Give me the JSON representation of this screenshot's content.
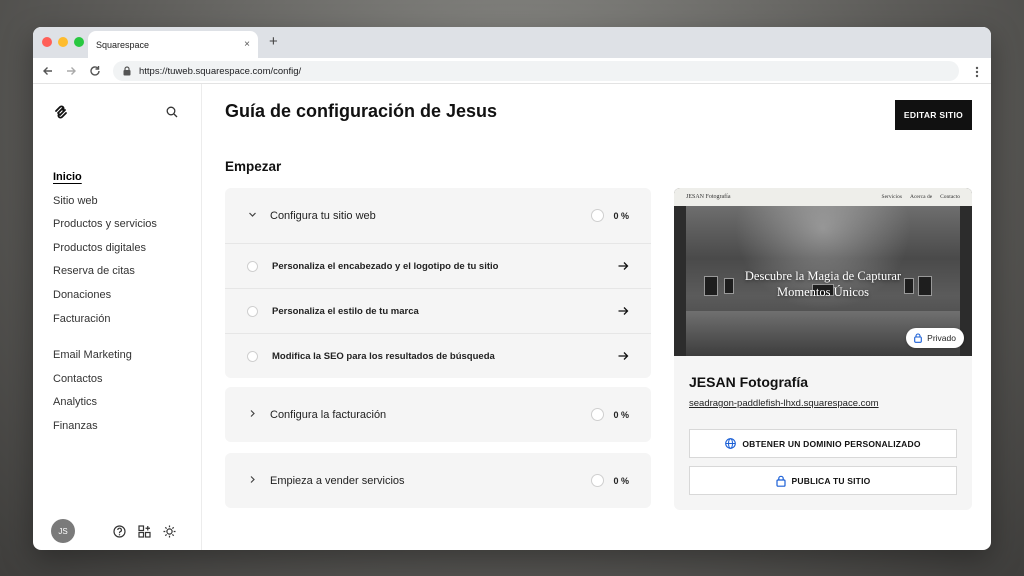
{
  "browser": {
    "tab_title": "Squarespace",
    "tab_close": "×",
    "new_tab": "+",
    "url": "https://tuweb.squarespace.com/config/"
  },
  "sidebar": {
    "nav_primary": [
      {
        "label": "Inicio",
        "active": true
      },
      {
        "label": "Sitio web"
      },
      {
        "label": "Productos y servicios"
      },
      {
        "label": "Productos digitales"
      },
      {
        "label": "Reserva de citas"
      },
      {
        "label": "Donaciones"
      },
      {
        "label": "Facturación"
      }
    ],
    "nav_secondary": [
      {
        "label": "Email Marketing"
      },
      {
        "label": "Contactos"
      },
      {
        "label": "Analytics"
      },
      {
        "label": "Finanzas"
      }
    ],
    "avatar_initials": "JS"
  },
  "main": {
    "title": "Guía de configuración de Jesus",
    "edit_button": "EDITAR SITIO",
    "section_title": "Empezar",
    "cards": [
      {
        "title": "Configura tu sitio web",
        "progress": "0 %",
        "expanded": true,
        "tasks": [
          "Personaliza el encabezado y el logotipo de tu sitio",
          "Personaliza el estilo de tu marca",
          "Modifica la SEO para los resultados de búsqueda"
        ]
      },
      {
        "title": "Configura la facturación",
        "progress": "0 %",
        "expanded": false
      },
      {
        "title": "Empieza a vender servicios",
        "progress": "0 %",
        "expanded": false
      }
    ]
  },
  "preview": {
    "thumb_brand": "JESAN Fotografía",
    "thumb_links": [
      "Servicios",
      "Acerca de",
      "Contacto"
    ],
    "hero_line1": "Descubre la Magia de Capturar",
    "hero_line2": "Momentos Únicos",
    "private_label": "Privado",
    "site_name": "JESAN Fotografía",
    "site_url": "seadragon-paddlefish-lhxd.squarespace.com",
    "domain_button": "OBTENER UN DOMINIO PERSONALIZADO",
    "publish_button": "PUBLICA TU SITIO"
  },
  "colors": {
    "accent_blue": "#1a5fd6",
    "primary_button": "#111111"
  }
}
